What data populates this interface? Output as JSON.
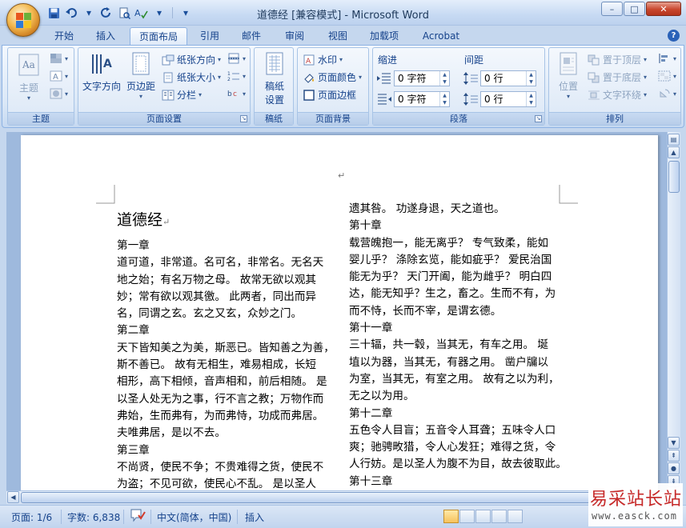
{
  "window": {
    "title": "道德经 [兼容模式] - Microsoft Word",
    "minimize": "–",
    "maximize": "□",
    "close": "✕"
  },
  "qat": {
    "save_icon": "save-icon",
    "undo_icon": "undo-icon",
    "redo_icon": "redo-icon"
  },
  "tabs": [
    {
      "label": "开始"
    },
    {
      "label": "插入"
    },
    {
      "label": "页面布局"
    },
    {
      "label": "引用"
    },
    {
      "label": "邮件"
    },
    {
      "label": "审阅"
    },
    {
      "label": "视图"
    },
    {
      "label": "加载项"
    },
    {
      "label": "Acrobat"
    }
  ],
  "help": "?",
  "ribbon": {
    "theme": {
      "label": "主题",
      "btn": "主题"
    },
    "page_setup": {
      "label": "页面设置",
      "text_direction": "文字方向",
      "margins": "页边距",
      "orientation": "纸张方向",
      "size": "纸张大小",
      "columns": "分栏"
    },
    "paper": {
      "label": "稿纸",
      "btn_line1": "稿纸",
      "btn_line2": "设置"
    },
    "page_bg": {
      "label": "页面背景",
      "watermark": "水印",
      "color": "页面颜色",
      "border": "页面边框"
    },
    "paragraph": {
      "label": "段落",
      "indent": "缩进",
      "spacing": "间距",
      "indent_left": "0 字符",
      "indent_right": "0 字符",
      "space_before": "0 行",
      "space_after": "0 行"
    },
    "arrange": {
      "label": "排列",
      "position": "位置",
      "bring_front": "置于顶层",
      "send_back": "置于底层",
      "wrap": "文字环绕"
    }
  },
  "document": {
    "title": "道德经",
    "left_column": [
      "第一章",
      "道可道，非常道。名可名，非常名。无名天",
      "地之始；有名万物之母。 故常无欲以观其",
      "妙；常有欲以观其徼。 此两者，同出而异",
      "名，同谓之玄。玄之又玄，众妙之门。",
      "第二章",
      "天下皆知美之为美，斯恶已。皆知善之为善，",
      "斯不善已。 故有无相生，难易相成，长短",
      "相形，高下相倾，音声相和，前后相随。 是",
      "以圣人处无为之事，行不言之教；万物作而",
      "弗始，生而弗有，为而弗恃，功成而弗居。",
      "夫唯弗居，是以不去。",
      "第三章",
      "不尚贤，使民不争；不贵难得之货，使民不",
      "为盗；不见可欲，使民心不乱。 是以圣人"
    ],
    "right_column": [
      "遗其咎。 功遂身退，天之道也。",
      "第十章",
      "载营魄抱一，能无离乎？ 专气致柔，能如",
      "婴儿乎？ 涤除玄览，能如疵乎？ 爱民治国",
      "能无为乎？ 天门开阖，能为雌乎？ 明白四",
      "达，能无知乎？生之，畜之。生而不有，为",
      "而不恃，长而不宰，是谓玄德。",
      "第十一章",
      "三十辐，共一毂，当其无，有车之用。 埏",
      "埴以为器，当其无，有器之用。 凿户牖以",
      "为室，当其无，有室之用。 故有之以为利，",
      "无之以为用。",
      "第十二章",
      "五色令人目盲；五音令人耳聋；五味令人口",
      "爽；驰骋畋猎，令人心发狂；难得之货，令",
      "人行妨。是以圣人为腹不为目，故去彼取此。",
      "第十三章"
    ]
  },
  "status": {
    "page": "页面: 1/6",
    "words": "字数: 6,838",
    "language": "中文(简体，中国)",
    "mode": "插入"
  },
  "watermark": {
    "name": "易采站长站",
    "url": "www.easck.com"
  }
}
